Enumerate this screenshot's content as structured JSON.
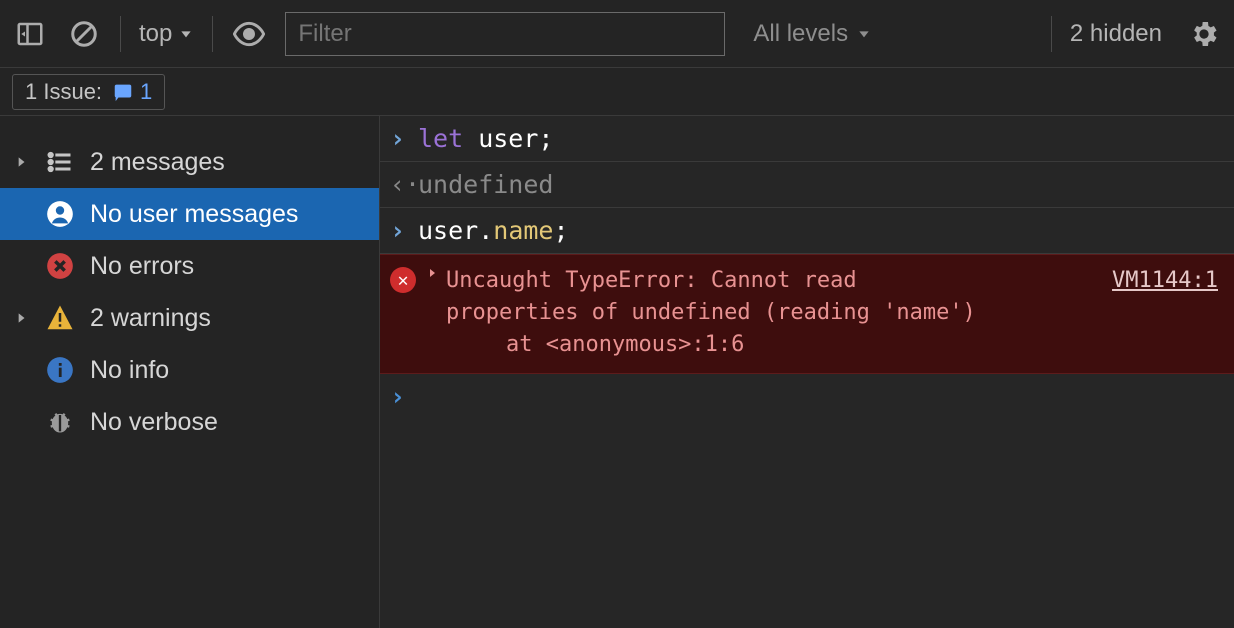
{
  "toolbar": {
    "context_label": "top",
    "filter_placeholder": "Filter",
    "levels_label": "All levels",
    "hidden_label": "2 hidden"
  },
  "issues": {
    "label": "1 Issue:",
    "count": "1"
  },
  "sidebar": {
    "items": [
      {
        "label": "2 messages"
      },
      {
        "label": "No user messages"
      },
      {
        "label": "No errors"
      },
      {
        "label": "2 warnings"
      },
      {
        "label": "No info"
      },
      {
        "label": "No verbose"
      }
    ]
  },
  "console": {
    "line1_let": "let",
    "line1_var": " user;",
    "line2_undefined": "undefined",
    "line3_obj": "user",
    "line3_dot": ".",
    "line3_prop": "name",
    "line3_semi": ";",
    "error": {
      "title_line1": "Uncaught TypeError: Cannot read",
      "source": "VM1144:1",
      "title_line2": "properties of undefined (reading 'name')",
      "stack": "at <anonymous>:1:6"
    }
  }
}
